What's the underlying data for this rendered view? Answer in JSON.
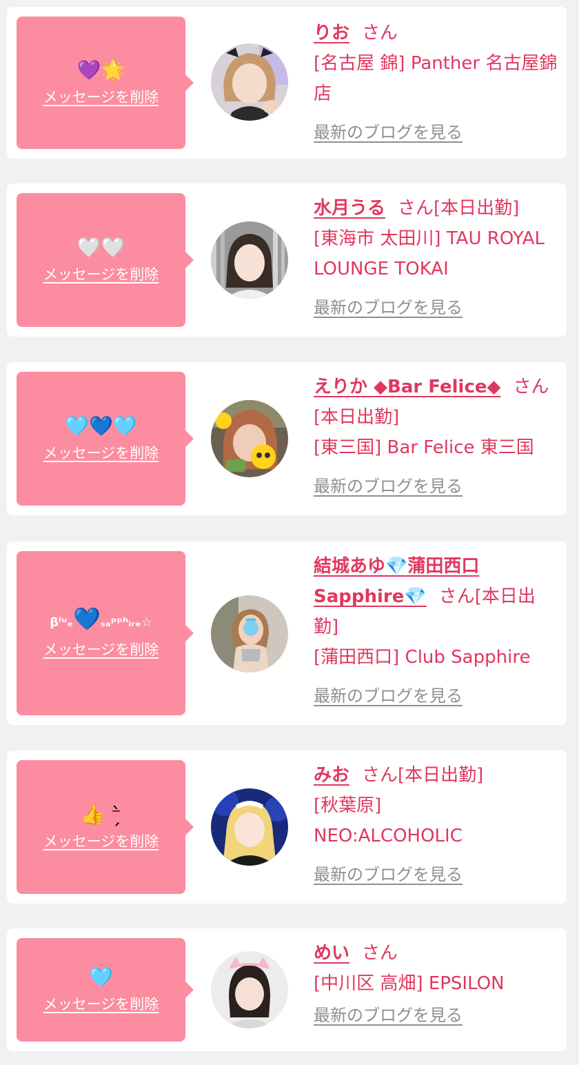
{
  "delete_label": "メッセージを削除",
  "blog_label": "最新のブログを見る",
  "san_label": "さん",
  "colors": {
    "bubble": "#fc8ca0",
    "accent": "#e0375e",
    "link_gray": "#8f8f8f",
    "background": "#f1f1f1"
  },
  "entries": [
    {
      "emoji": "💜🌟",
      "name": "りお",
      "san": "さん",
      "status": "",
      "shop": "[名古屋 錦] Panther 名古屋錦店",
      "avatar_icon": "girl-photo-avatar"
    },
    {
      "emoji": "🤍🤍",
      "name": "水月うる",
      "san": "さん",
      "status": "[本日出勤]",
      "shop": "[東海市 太田川] TAU ROYAL LOUNGE TOKAI",
      "avatar_icon": "girl-photo-avatar"
    },
    {
      "emoji": "🩵💙🩵",
      "name": "えりか ◆Bar Felice◆",
      "san": "さん",
      "status": "[本日出勤]",
      "shop": "[東三国] Bar Felice 東三国",
      "avatar_icon": "girl-photo-avatar"
    },
    {
      "emoji_pre": "βˡᵘₑ",
      "emoji_heart": "💙",
      "emoji_post": "ₛₐᵖᵖʰᵢᵣₑ☆",
      "name": "結城あゆ💎蒲田西口Sapphire💎",
      "san": "さん",
      "status": "[本日出勤]",
      "shop": "[蒲田西口] Club Sapphire",
      "avatar_icon": "girl-photo-avatar"
    },
    {
      "emoji": "👍 ⁻̗̀",
      "name": "みお",
      "san": "さん",
      "status": "[本日出勤]",
      "shop": "[秋葉原] NEO:ALCOHOLIC",
      "avatar_icon": "girl-photo-avatar"
    },
    {
      "emoji": "🩵",
      "name": "めい",
      "san": "さん",
      "status": "",
      "shop": "[中川区 高畑] EPSILON",
      "avatar_icon": "girl-photo-avatar"
    }
  ]
}
